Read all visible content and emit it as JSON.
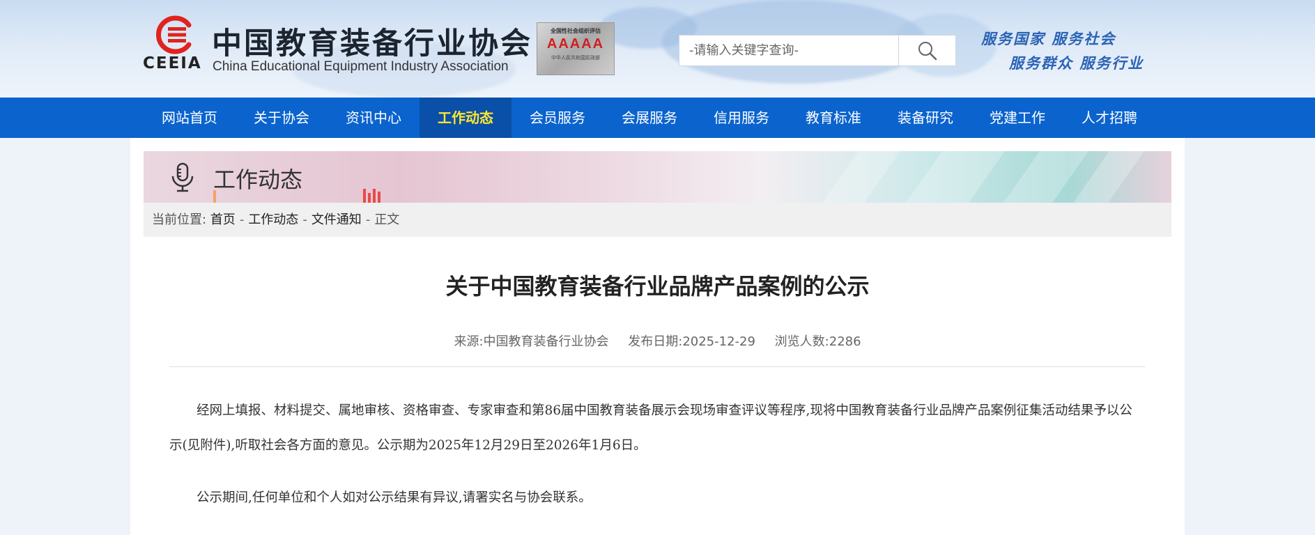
{
  "colors": {
    "nav_bg": "#0b63ce",
    "nav_active_bg": "#0a4fa8",
    "nav_active_text": "#ffe62e",
    "logo_red": "#e0231e",
    "slogan_blue": "#2a63b5"
  },
  "header": {
    "logo_text": "CEEIA",
    "title_cn": "中国教育装备行业协会",
    "title_en": "China Educational Equipment Industry Association",
    "badge": {
      "top": "全国性社会组织评估",
      "grade": "AAAAA",
      "bottom": "中华人民共和国民政部"
    },
    "search": {
      "placeholder": "-请输入关键字查询-",
      "icon": "search-icon"
    },
    "slogan_line1": "服务国家 服务社会",
    "slogan_line2": "服务群众 服务行业"
  },
  "nav": {
    "items": [
      {
        "label": "网站首页"
      },
      {
        "label": "关于协会"
      },
      {
        "label": "资讯中心"
      },
      {
        "label": "工作动态",
        "active": true
      },
      {
        "label": "会员服务"
      },
      {
        "label": "会展服务"
      },
      {
        "label": "信用服务"
      },
      {
        "label": "教育标准"
      },
      {
        "label": "装备研究"
      },
      {
        "label": "党建工作"
      },
      {
        "label": "人才招聘"
      }
    ]
  },
  "banner": {
    "title": "工作动态",
    "icon": "microphone-icon"
  },
  "breadcrumb": {
    "prefix": "当前位置:",
    "home": "首页",
    "section": "工作动态",
    "subsection": "文件通知",
    "current": "正文",
    "separator": "-"
  },
  "article": {
    "title": "关于中国教育装备行业品牌产品案例的公示",
    "source": "来源:中国教育装备行业协会",
    "date": "发布日期:2025-12-29",
    "views": "浏览人数:2286",
    "paragraphs": [
      "经网上填报、材料提交、属地审核、资格审查、专家审查和第86届中国教育装备展示会现场审查评议等程序,现将中国教育装备行业品牌产品案例征集活动结果予以公示(见附件),听取社会各方面的意见。公示期为2025年12月29日至2026年1月6日。",
      "公示期间,任何单位和个人如对公示结果有异议,请署实名与协会联系。"
    ]
  }
}
